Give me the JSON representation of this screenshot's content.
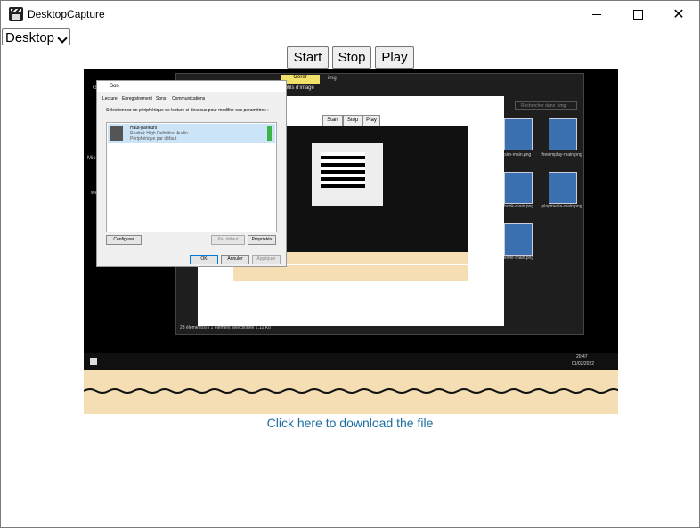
{
  "window": {
    "title": "DesktopCapture",
    "controls": {
      "minimize": "minimize-icon",
      "maximize": "maximize-icon",
      "close": "✕"
    }
  },
  "source_select": {
    "value": "Desktop"
  },
  "controls": {
    "start": "Start",
    "stop": "Stop",
    "play": "Play"
  },
  "preview": {
    "sound_dialog": {
      "title": "Son",
      "tabs": [
        "Lecture",
        "Enregistrement",
        "Sons",
        "Communications"
      ],
      "instruction": "Sélectionnez un périphérique de lecture ci-dessous pour modifier ses paramètres :",
      "device_name": "Haut-parleurs",
      "device_driver": "Realtek High Definition Audio",
      "device_status": "Périphérique par défaut",
      "configure": "Configurer",
      "default": "Par défaut",
      "properties": "Propriétés",
      "ok": "OK",
      "cancel": "Annuler",
      "apply": "Appliquer"
    },
    "explorer": {
      "ribbon_tab": "Gérer",
      "ribbon_sub": "Outils d'image",
      "folder": "img",
      "search_placeholder": "Rechercher dans : img",
      "files": [
        "giftsim-main.png",
        "freeimplay-main.png",
        "playbook-main.png",
        "playmedia-main.png",
        "dbviewer-main.png"
      ],
      "status": "23 élément(s)   |   1 élément sélectionné  1,12 Ko"
    },
    "nested_controls": [
      "Start",
      "Stop",
      "Play"
    ],
    "taskbar": {
      "time": "20:47",
      "date": "01/02/2022"
    },
    "desktop_labels": [
      "Git",
      "Mic",
      "we"
    ]
  },
  "download_link": "Click here to download the file"
}
